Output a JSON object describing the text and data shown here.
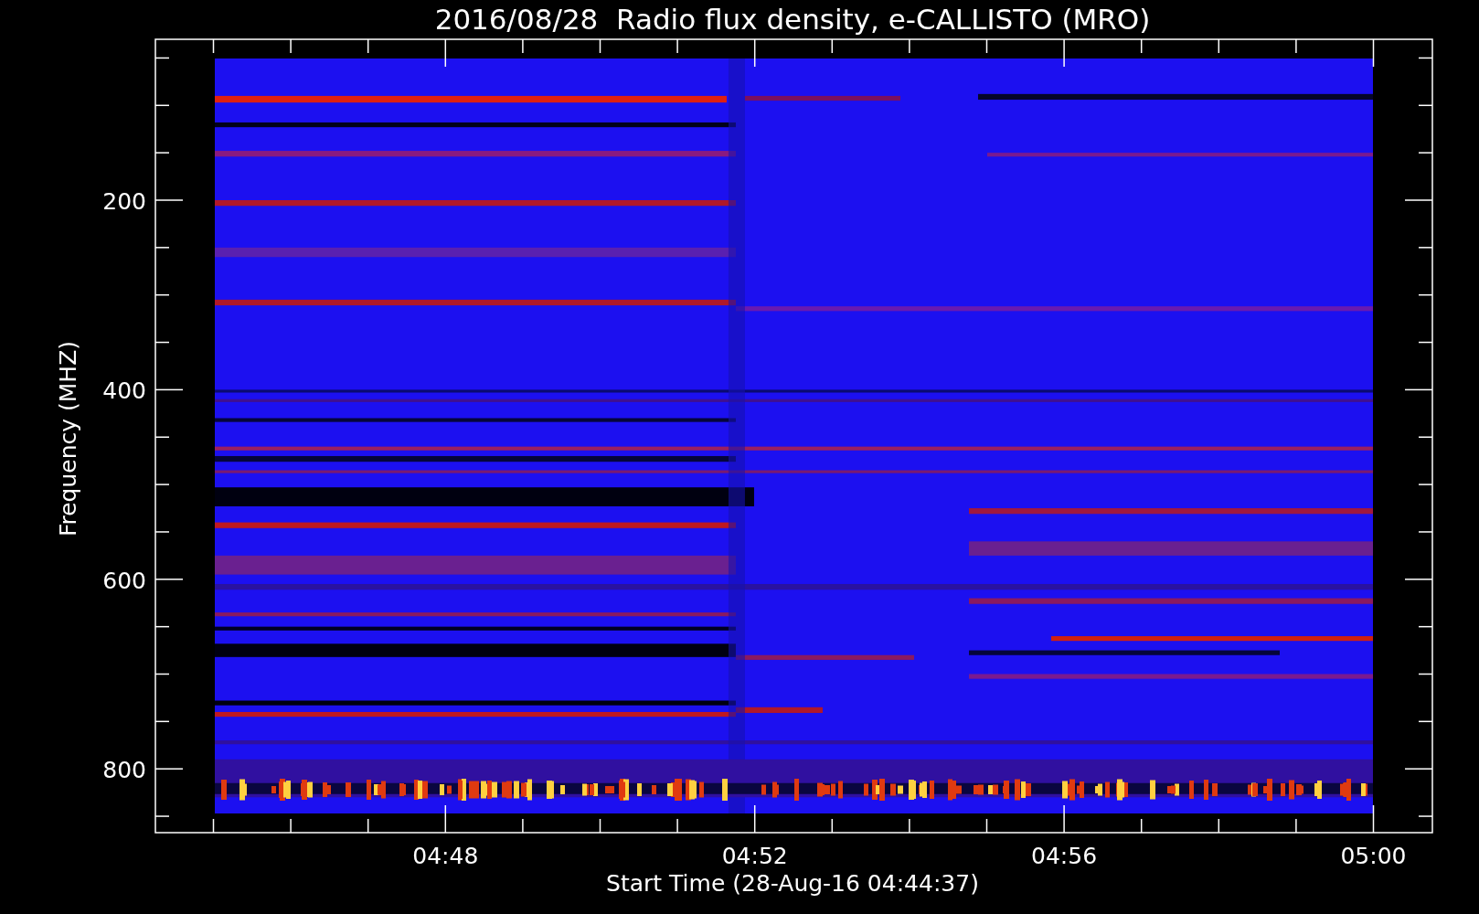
{
  "title": "2016/08/28  Radio flux density, e-CALLISTO (MRO)",
  "y_axis": {
    "label": "Frequency (MHZ)",
    "ticks": [
      "200",
      "400",
      "600",
      "800"
    ]
  },
  "x_axis": {
    "label": "Start Time (28-Aug-16 04:44:37)",
    "ticks": [
      "04:48",
      "04:52",
      "04:56",
      "05:00"
    ]
  }
}
